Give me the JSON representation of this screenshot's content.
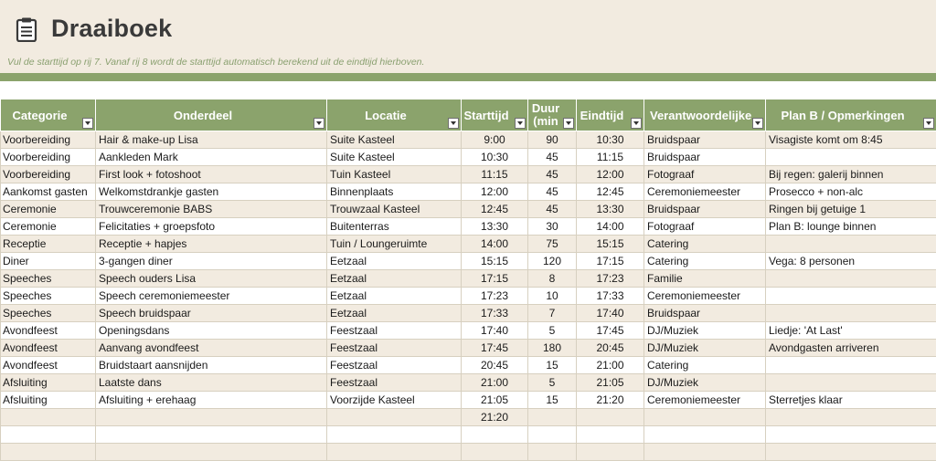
{
  "header": {
    "title": "Draaiboek",
    "subtitle": "Vul de starttijd op rij 7. Vanaf rij 8 wordt de starttijd automatisch berekend uit de eindtijd hierboven."
  },
  "columns": [
    {
      "label": "Categorie",
      "label2": ""
    },
    {
      "label": "Onderdeel",
      "label2": ""
    },
    {
      "label": "Locatie",
      "label2": ""
    },
    {
      "label": "Starttijd",
      "label2": ""
    },
    {
      "label": "Duur",
      "label2": "(min"
    },
    {
      "label": "Eindtijd",
      "label2": ""
    },
    {
      "label": "Verantwoordelijke",
      "label2": ""
    },
    {
      "label": "Plan B / Opmerkingen",
      "label2": ""
    }
  ],
  "rows": [
    [
      "Voorbereiding",
      "Hair & make-up Lisa",
      "Suite Kasteel",
      "9:00",
      "90",
      "10:30",
      "Bruidspaar",
      "Visagiste komt om 8:45"
    ],
    [
      "Voorbereiding",
      "Aankleden Mark",
      "Suite Kasteel",
      "10:30",
      "45",
      "11:15",
      "Bruidspaar",
      ""
    ],
    [
      "Voorbereiding",
      "First look + fotoshoot",
      "Tuin Kasteel",
      "11:15",
      "45",
      "12:00",
      "Fotograaf",
      "Bij regen: galerij binnen"
    ],
    [
      "Aankomst gasten",
      "Welkomstdrankje gasten",
      "Binnenplaats",
      "12:00",
      "45",
      "12:45",
      "Ceremoniemeester",
      "Prosecco + non-alc"
    ],
    [
      "Ceremonie",
      "Trouwceremonie BABS",
      "Trouwzaal Kasteel",
      "12:45",
      "45",
      "13:30",
      "Bruidspaar",
      "Ringen bij getuige 1"
    ],
    [
      "Ceremonie",
      "Felicitaties + groepsfoto",
      "Buitenterras",
      "13:30",
      "30",
      "14:00",
      "Fotograaf",
      "Plan B: lounge binnen"
    ],
    [
      "Receptie",
      "Receptie + hapjes",
      "Tuin / Loungeruimte",
      "14:00",
      "75",
      "15:15",
      "Catering",
      ""
    ],
    [
      "Diner",
      "3-gangen diner",
      "Eetzaal",
      "15:15",
      "120",
      "17:15",
      "Catering",
      "Vega: 8 personen"
    ],
    [
      "Speeches",
      "Speech ouders Lisa",
      "Eetzaal",
      "17:15",
      "8",
      "17:23",
      "Familie",
      ""
    ],
    [
      "Speeches",
      "Speech ceremoniemeester",
      "Eetzaal",
      "17:23",
      "10",
      "17:33",
      "Ceremoniemeester",
      ""
    ],
    [
      "Speeches",
      "Speech bruidspaar",
      "Eetzaal",
      "17:33",
      "7",
      "17:40",
      "Bruidspaar",
      ""
    ],
    [
      "Avondfeest",
      "Openingsdans",
      "Feestzaal",
      "17:40",
      "5",
      "17:45",
      "DJ/Muziek",
      "Liedje: 'At Last'"
    ],
    [
      "Avondfeest",
      "Aanvang avondfeest",
      "Feestzaal",
      "17:45",
      "180",
      "20:45",
      "DJ/Muziek",
      "Avondgasten arriveren"
    ],
    [
      "Avondfeest",
      "Bruidstaart aansnijden",
      "Feestzaal",
      "20:45",
      "15",
      "21:00",
      "Catering",
      ""
    ],
    [
      "Afsluiting",
      "Laatste dans",
      "Feestzaal",
      "21:00",
      "5",
      "21:05",
      "DJ/Muziek",
      ""
    ],
    [
      "Afsluiting",
      "Afsluiting + erehaag",
      "Voorzijde Kasteel",
      "21:05",
      "15",
      "21:20",
      "Ceremoniemeester",
      "Sterretjes klaar"
    ],
    [
      "",
      "",
      "",
      "21:20",
      "",
      "",
      "",
      ""
    ],
    [
      "",
      "",
      "",
      "",
      "",
      "",
      "",
      ""
    ],
    [
      "",
      "",
      "",
      "",
      "",
      "",
      "",
      ""
    ]
  ],
  "icons": {
    "title": "clipboard-icon",
    "filter": "dropdown-arrow-icon"
  },
  "colors": {
    "header_bg": "#f2ebe0",
    "accent": "#8ba36c",
    "subtitle": "#8aa070"
  }
}
